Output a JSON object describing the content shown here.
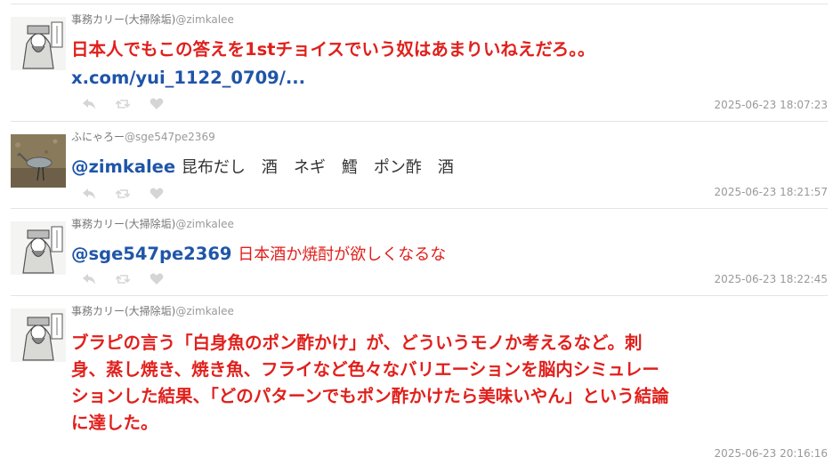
{
  "tweets": [
    {
      "name": "事務カリー(大掃除垢)",
      "handle": "@zimkalee",
      "mention": "",
      "lines": [
        "日本人でもこの答えを1stチョイスでいう奴はあまりいねえだろ。。"
      ],
      "link": "x.com/yui_1122_0709/...",
      "timestamp": "2025-06-23 18:07:23"
    },
    {
      "name": "ふにゃろー",
      "handle": "@sge547pe2369",
      "mention": "@zimkalee",
      "lines": [
        "昆布だし　酒　ネギ　鱈　ポン酢　酒"
      ],
      "timestamp": "2025-06-23 18:21:57"
    },
    {
      "name": "事務カリー(大掃除垢)",
      "handle": "@zimkalee",
      "mention": "@sge547pe2369",
      "lines": [
        "日本酒か焼酎が欲しくなるな"
      ],
      "timestamp": "2025-06-23 18:22:45"
    },
    {
      "name": "事務カリー(大掃除垢)",
      "handle": "@zimkalee",
      "mention": "",
      "lines": [
        "ブラピの言う「白身魚のポン酢かけ」が、どういうモノか考えるなど。刺",
        "身、蒸し焼き、焼き魚、フライなど色々なバリエーションを脳内シミュレー",
        "ションした結果、「どのパターンでもポン酢かけたら美味いやん」という結論",
        "に達した。"
      ],
      "timestamp": "2025-06-23 20:16:16"
    }
  ],
  "icons": [
    "reply-icon",
    "retweet-icon",
    "like-icon"
  ],
  "colors": {
    "emphasis_text": "#e0201c",
    "mention_link": "#1f55a8",
    "meta_text": "#999999"
  }
}
